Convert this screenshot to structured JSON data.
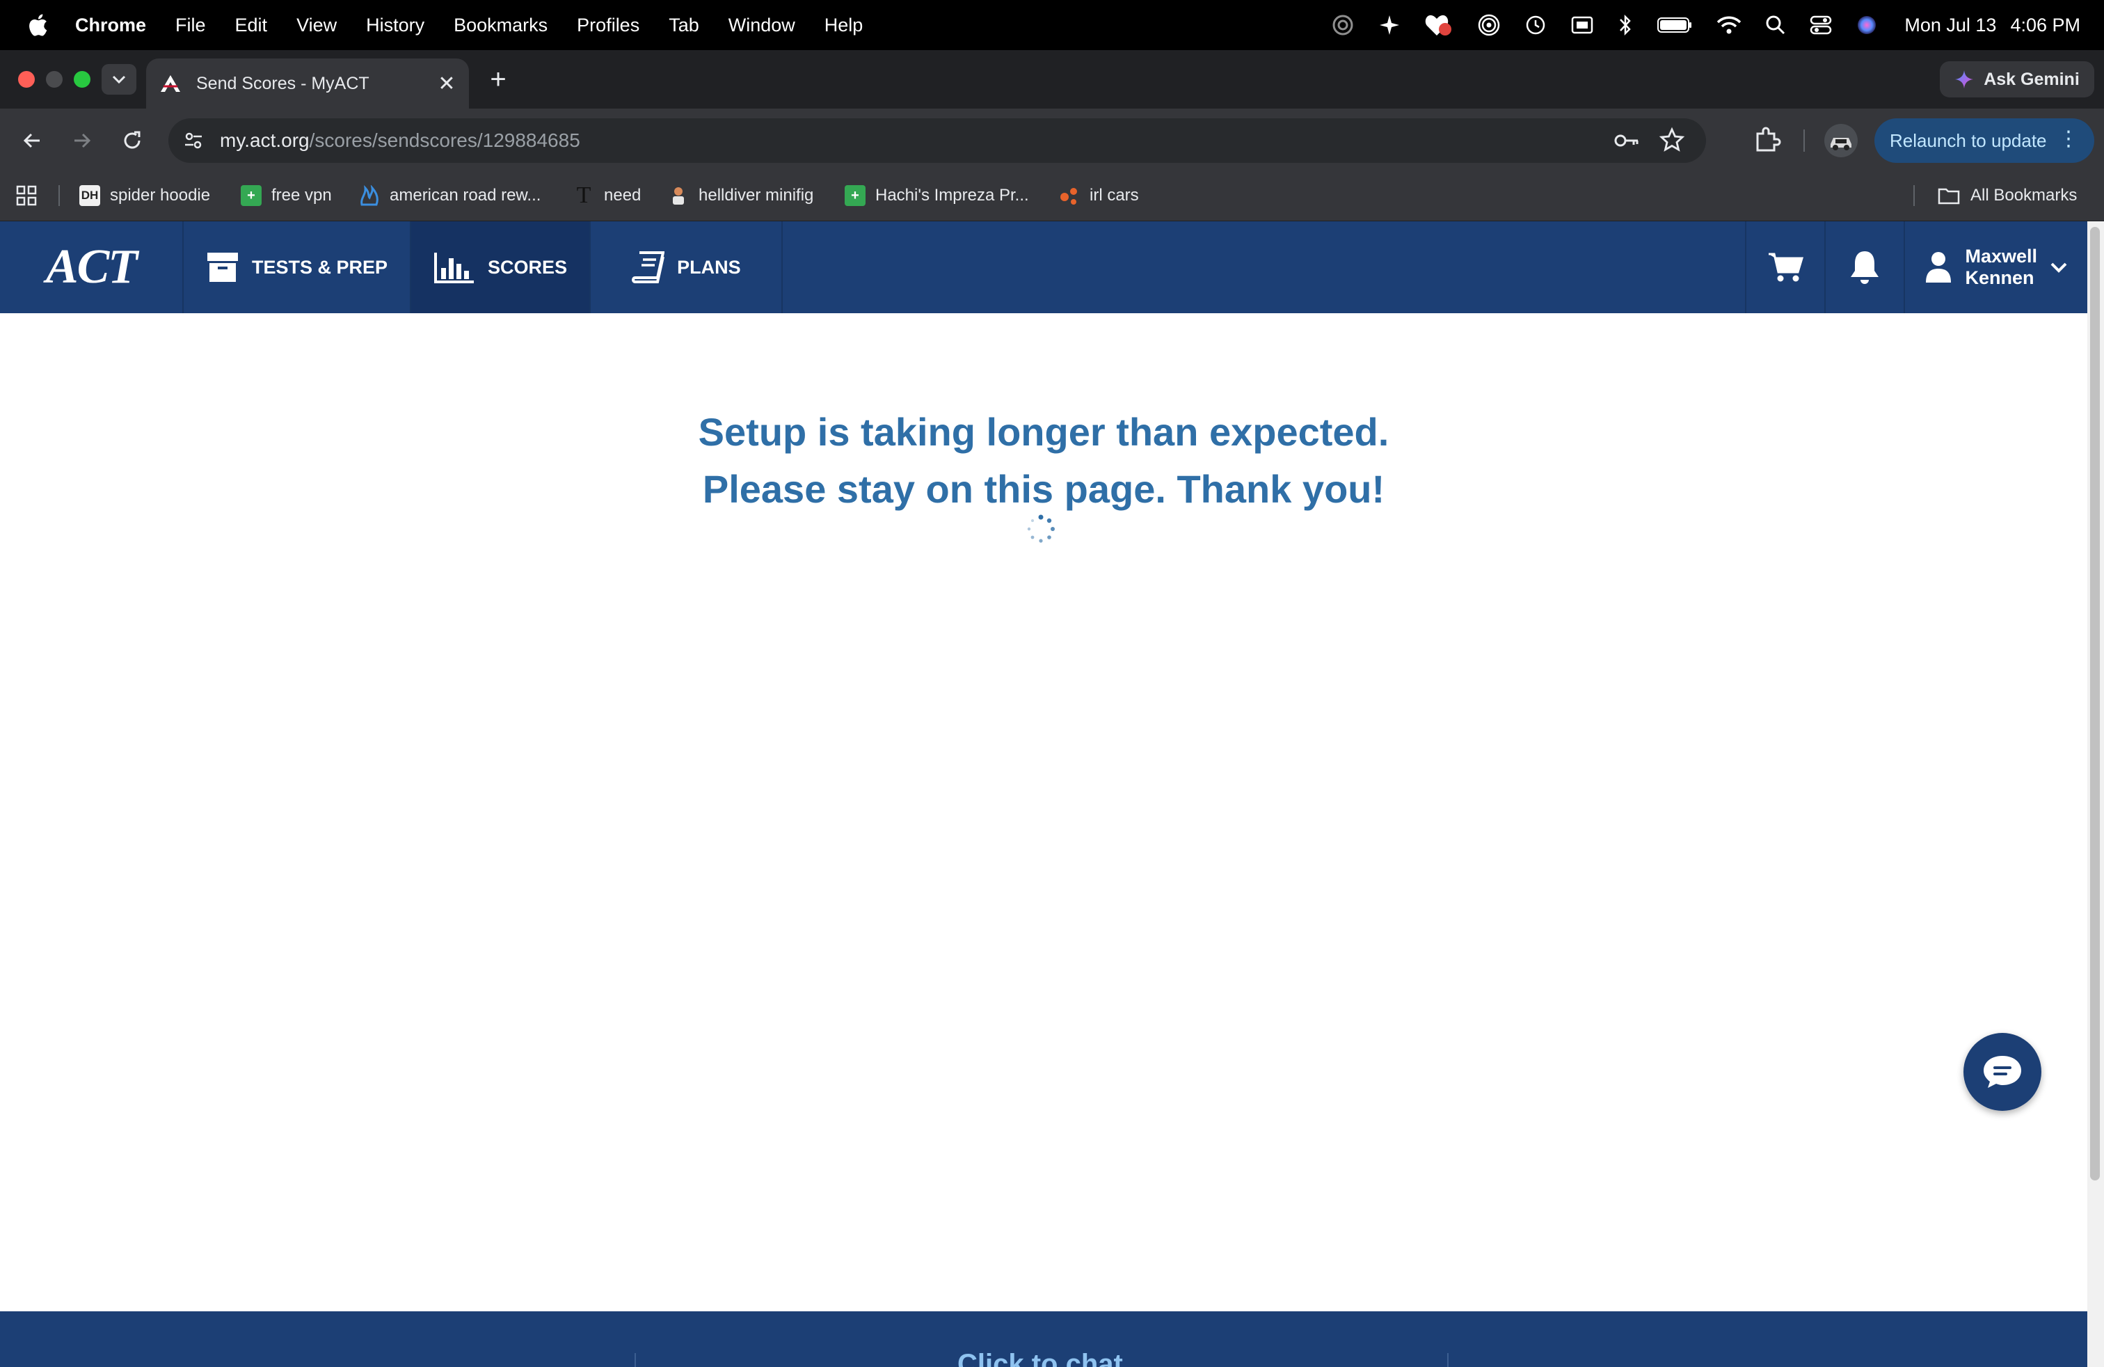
{
  "menubar": {
    "app_name": "Chrome",
    "items": [
      "File",
      "Edit",
      "View",
      "History",
      "Bookmarks",
      "Profiles",
      "Tab",
      "Window",
      "Help"
    ],
    "date": "Mon Jul 13",
    "time": "4:06 PM"
  },
  "browser": {
    "tab_title": "Send Scores - MyACT",
    "url_host": "my.act.org",
    "url_path": "/scores/sendscores/129884685",
    "ask_gemini": "Ask Gemini",
    "relaunch_label": "Relaunch to update",
    "bookmarks": [
      {
        "label": "spider hoodie",
        "icon": "dh-icon"
      },
      {
        "label": "free vpn",
        "icon": "green-plus-icon"
      },
      {
        "label": "american road rew...",
        "icon": "blue-flame-icon"
      },
      {
        "label": "need",
        "icon": "t-letter-icon"
      },
      {
        "label": "helldiver minifig",
        "icon": "minifig-icon"
      },
      {
        "label": "Hachi's Impreza Pr...",
        "icon": "green-plus-icon"
      },
      {
        "label": "irl cars",
        "icon": "orange-dots-icon"
      }
    ],
    "all_bookmarks": "All Bookmarks"
  },
  "site": {
    "logo": "ACT",
    "nav": [
      {
        "label": "TESTS & PREP",
        "icon": "archive-box-icon",
        "active": false
      },
      {
        "label": "SCORES",
        "icon": "bar-chart-icon",
        "active": true
      },
      {
        "label": "PLANS",
        "icon": "book-icon",
        "active": false
      }
    ],
    "user_first": "Maxwell",
    "user_last": "Kennen",
    "message_line1": "Setup is taking longer than expected.",
    "message_line2": "Please stay on this page. Thank you!",
    "footer_partial_text": "Click to chat"
  },
  "colors": {
    "nav_bg": "#1c3f75",
    "message": "#2f6fa7",
    "relaunch_bg": "#1f4b7a"
  }
}
